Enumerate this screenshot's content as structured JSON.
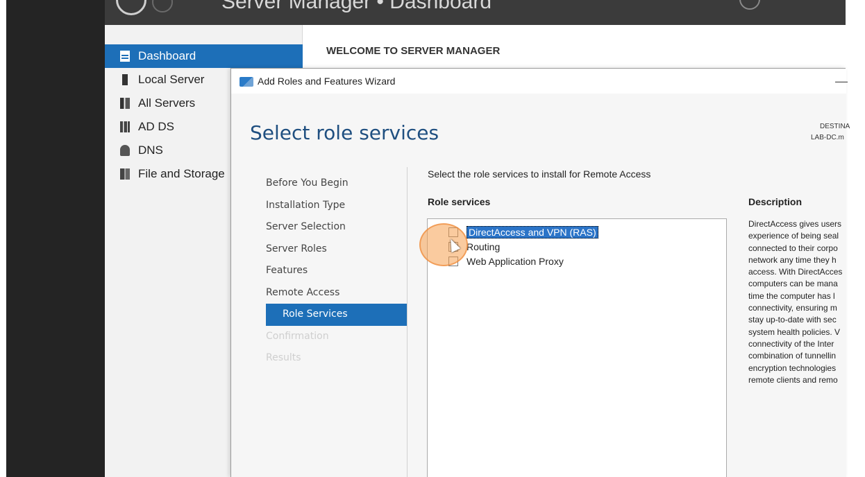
{
  "server_manager": {
    "title": "Server Manager • Dashboard",
    "sidebar": {
      "items": [
        {
          "label": "Dashboard",
          "icon": "dashboard-icon",
          "active": true
        },
        {
          "label": "Local Server",
          "icon": "server-icon"
        },
        {
          "label": "All Servers",
          "icon": "servers-icon"
        },
        {
          "label": "AD DS",
          "icon": "ad-ds-icon"
        },
        {
          "label": "DNS",
          "icon": "dns-icon"
        },
        {
          "label": "File and Storage",
          "icon": "file-storage-icon"
        }
      ]
    },
    "main_header": "WELCOME TO SERVER MANAGER"
  },
  "wizard": {
    "window_title": "Add Roles and Features Wizard",
    "minimize_glyph": "—",
    "page_title": "Select role services",
    "destination_label": "DESTINA",
    "destination_server": "LAB-DC.m",
    "steps": [
      {
        "label": "Before You Begin",
        "state": "normal"
      },
      {
        "label": "Installation Type",
        "state": "normal"
      },
      {
        "label": "Server Selection",
        "state": "normal"
      },
      {
        "label": "Server Roles",
        "state": "normal"
      },
      {
        "label": "Features",
        "state": "normal"
      },
      {
        "label": "Remote Access",
        "state": "normal"
      },
      {
        "label": "Role Services",
        "state": "active"
      },
      {
        "label": "Confirmation",
        "state": "disabled"
      },
      {
        "label": "Results",
        "state": "disabled"
      }
    ],
    "instruction": "Select the role services to install for Remote Access",
    "role_services_header": "Role services",
    "role_services": [
      {
        "label": "DirectAccess and VPN (RAS)",
        "checked": false,
        "selected": true
      },
      {
        "label": "Routing",
        "checked": false,
        "selected": false
      },
      {
        "label": "Web Application Proxy",
        "checked": false,
        "selected": false
      }
    ],
    "description_header": "Description",
    "description_lines": [
      "DirectAccess gives users",
      "experience of being seal",
      "connected to their corpo",
      "network any time they h",
      "access. With DirectAcces",
      "computers can be mana",
      "time the computer has l",
      "connectivity, ensuring m",
      "stay up-to-date with sec",
      "system health policies. V",
      "connectivity of the Inter",
      "combination of tunnellin",
      "encryption technologies",
      "remote clients and remo"
    ]
  },
  "colors": {
    "accent": "#1d6fb8",
    "titlebar": "#3b3b3b",
    "page_title": "#1f4f80"
  }
}
